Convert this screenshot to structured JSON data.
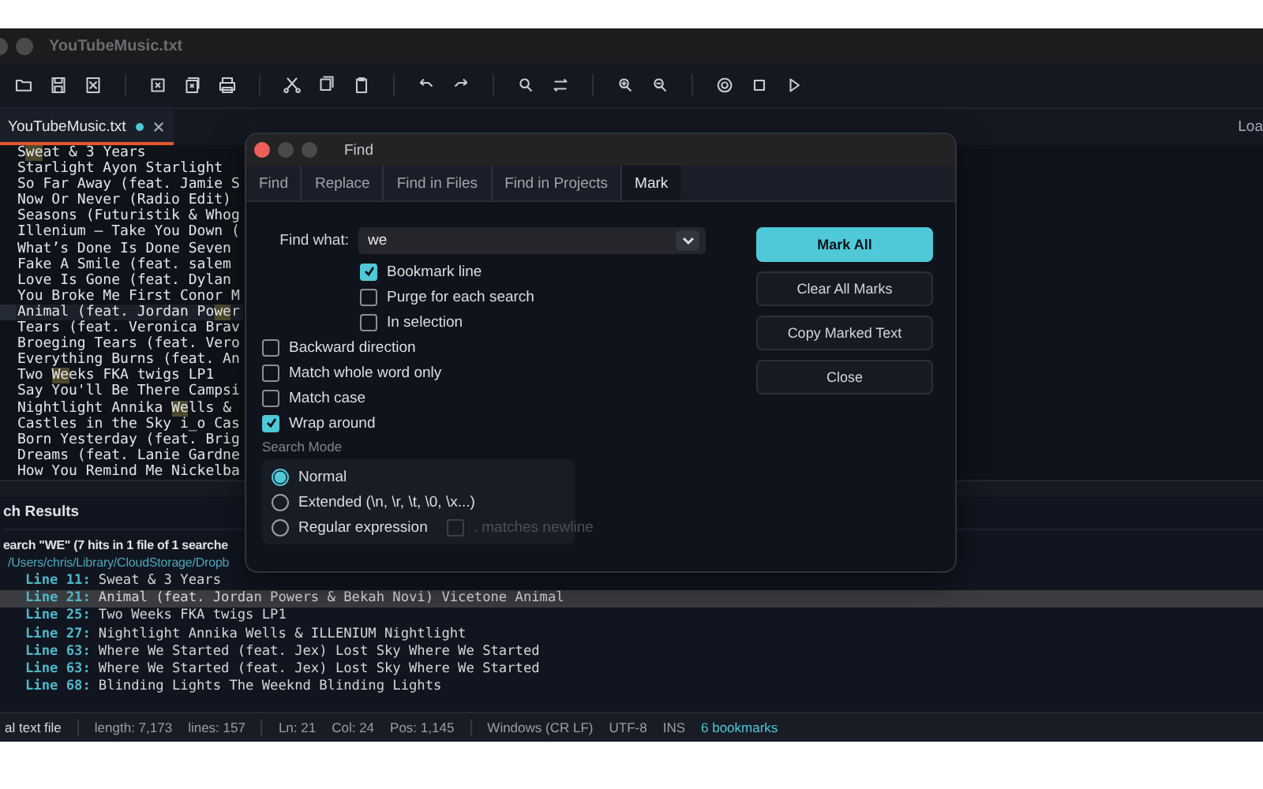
{
  "window": {
    "title": "YouTubeMusic.txt"
  },
  "tabs": [
    {
      "label": "YouTubeMusic.txt",
      "selected": true,
      "modified": true
    }
  ],
  "tab_bar_right": "Loa",
  "editor": {
    "lines": [
      {
        "current": false,
        "segments": [
          {
            "t": "S",
            "hit": false
          },
          {
            "t": "we",
            "hit": true
          },
          {
            "t": "at & 3 Years",
            "hit": false
          }
        ]
      },
      {
        "current": false,
        "segments": [
          {
            "t": "Starlight Ayon Starlight",
            "hit": false
          }
        ]
      },
      {
        "current": false,
        "segments": [
          {
            "t": "So Far Away (feat. Jamie S",
            "hit": false
          }
        ]
      },
      {
        "current": false,
        "segments": [
          {
            "t": "Now Or Never (Radio Edit)",
            "hit": false
          }
        ]
      },
      {
        "current": false,
        "segments": [
          {
            "t": "Seasons (Futuristik & Whog",
            "hit": false
          }
        ]
      },
      {
        "current": false,
        "segments": [
          {
            "t": "Illenium – Take You Down (",
            "hit": false
          }
        ]
      },
      {
        "current": false,
        "segments": [
          {
            "t": "What’s Done Is Done Seven",
            "hit": false
          }
        ]
      },
      {
        "current": false,
        "segments": [
          {
            "t": "Fake A Smile (feat. salem",
            "hit": false
          }
        ]
      },
      {
        "current": false,
        "segments": [
          {
            "t": "Love Is Gone (feat. Dylan",
            "hit": false
          }
        ]
      },
      {
        "current": false,
        "segments": [
          {
            "t": "You Broke Me First Conor M",
            "hit": false
          }
        ]
      },
      {
        "current": true,
        "segments": [
          {
            "t": "Animal (feat. Jordan Po",
            "hit": false
          },
          {
            "t": "we",
            "hit": true
          },
          {
            "t": "r",
            "hit": false
          }
        ]
      },
      {
        "current": false,
        "segments": [
          {
            "t": "Tears (feat. Veronica Brav",
            "hit": false
          }
        ]
      },
      {
        "current": false,
        "segments": [
          {
            "t": "Broeging Tears (feat. Vero",
            "hit": false
          }
        ]
      },
      {
        "current": false,
        "segments": [
          {
            "t": "Everything Burns (feat. An",
            "hit": false
          }
        ]
      },
      {
        "current": false,
        "segments": [
          {
            "t": "Two ",
            "hit": false
          },
          {
            "t": "We",
            "hit": true
          },
          {
            "t": "eks FKA twigs LP1",
            "hit": false
          }
        ]
      },
      {
        "current": false,
        "segments": [
          {
            "t": "Say You'll Be There Campsi",
            "hit": false
          }
        ]
      },
      {
        "current": false,
        "segments": [
          {
            "t": "Nightlight Annika ",
            "hit": false
          },
          {
            "t": "We",
            "hit": true
          },
          {
            "t": "lls &",
            "hit": false
          }
        ]
      },
      {
        "current": false,
        "segments": [
          {
            "t": "Castles in the Sky i_o Cas",
            "hit": false
          }
        ]
      },
      {
        "current": false,
        "segments": [
          {
            "t": "Born Yesterday (feat. Brig",
            "hit": false
          }
        ]
      },
      {
        "current": false,
        "segments": [
          {
            "t": "Dreams (feat. Lanie Gardne",
            "hit": false
          }
        ]
      },
      {
        "current": false,
        "segments": [
          {
            "t": "How You Remind Me Nickelba",
            "hit": false
          }
        ]
      }
    ]
  },
  "search_results": {
    "title": "ch Results",
    "summary": "earch \"WE\" (7 hits in 1 file of 1 searche",
    "path": "/Users/chris/Library/CloudStorage/Dropb",
    "hits": [
      {
        "line": "Line 11:",
        "text": "Sweat & 3 Years",
        "selected": false
      },
      {
        "line": "Line 21:",
        "text": "Animal (feat. Jordan Powers & Bekah Novi) Vicetone Animal",
        "selected": true
      },
      {
        "line": "Line 25:",
        "text": "Two Weeks FKA twigs LP1",
        "selected": false
      },
      {
        "line": "Line 27:",
        "text": "Nightlight Annika Wells & ILLENIUM Nightlight",
        "selected": false
      },
      {
        "line": "Line 63:",
        "text": "Where We Started (feat. Jex) Lost Sky Where We Started",
        "selected": false
      },
      {
        "line": "Line 63:",
        "text": "Where We Started (feat. Jex) Lost Sky Where We Started",
        "selected": false
      },
      {
        "line": "Line 68:",
        "text": "Blinding Lights The Weeknd Blinding Lights",
        "selected": false
      }
    ]
  },
  "status_bar": [
    {
      "text": "al text file",
      "accent": false
    },
    {
      "text": "length: 7,173",
      "accent": false
    },
    {
      "text": "lines: 157",
      "accent": false
    },
    {
      "text": "Ln: 21",
      "accent": false
    },
    {
      "text": "Col: 24",
      "accent": false
    },
    {
      "text": "Pos: 1,145",
      "accent": false
    },
    {
      "text": "Windows (CR LF)",
      "accent": false
    },
    {
      "text": "UTF-8",
      "accent": false
    },
    {
      "text": "INS",
      "accent": false
    },
    {
      "text": "6 bookmarks",
      "accent": true
    }
  ],
  "find_dialog": {
    "title": "Find",
    "tabs": [
      {
        "label": "Find",
        "selected": false
      },
      {
        "label": "Replace",
        "selected": false
      },
      {
        "label": "Find in Files",
        "selected": false
      },
      {
        "label": "Find in Projects",
        "selected": false
      },
      {
        "label": "Mark",
        "selected": true
      }
    ],
    "find_what": {
      "label": "Find what:",
      "value": "we"
    },
    "mark_options": [
      {
        "label": "Bookmark line",
        "checked": true
      },
      {
        "label": "Purge for each search",
        "checked": false
      },
      {
        "label": "In selection",
        "checked": false
      }
    ],
    "options": [
      {
        "label": "Backward direction",
        "checked": false
      },
      {
        "label": "Match whole word only",
        "checked": false
      },
      {
        "label": "Match case",
        "checked": false
      },
      {
        "label": "Wrap around",
        "checked": true
      }
    ],
    "search_mode": {
      "label": "Search Mode",
      "modes": [
        {
          "label": "Normal",
          "selected": true
        },
        {
          "label": "Extended (\\n, \\r, \\t, \\0, \\x...)",
          "selected": false
        },
        {
          "label": "Regular expression",
          "selected": false
        }
      ],
      "dot_newline": {
        "label": ". matches newline",
        "checked": false,
        "disabled": true
      }
    },
    "buttons": [
      {
        "label": "Mark All",
        "primary": true
      },
      {
        "label": "Clear All Marks",
        "primary": false
      },
      {
        "label": "Copy Marked Text",
        "primary": false
      },
      {
        "label": "Close",
        "primary": false
      }
    ]
  }
}
